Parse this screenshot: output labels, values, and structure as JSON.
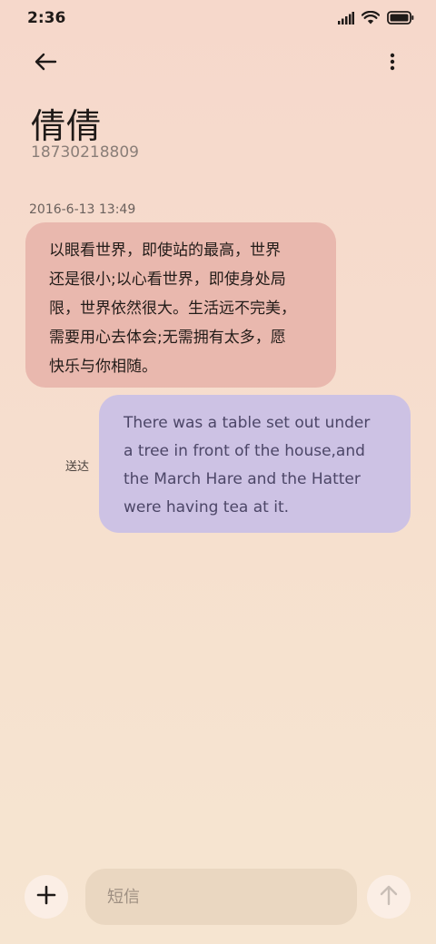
{
  "status_bar": {
    "time": "2:36",
    "icons": [
      "signal-icon",
      "wifi-icon",
      "battery-icon"
    ]
  },
  "header": {
    "back_icon": "back-arrow-icon",
    "more_icon": "more-vertical-icon",
    "contact_name": "倩倩",
    "contact_number": "18730218809"
  },
  "conversation": {
    "timestamp": "2016-6-13 13:49",
    "messages": [
      {
        "direction": "incoming",
        "lines": [
          "以眼看世界，即使站的最高，世界",
          "还是很小;以心看世界，即使身处局",
          "限，世界依然很大。生活远不完美，",
          "需要用心去体会;无需拥有太多，愿",
          "快乐与你相随。"
        ]
      },
      {
        "direction": "outgoing",
        "status": "送达",
        "lines": [
          "There was a table set out under",
          "a tree in front of the house,and",
          "the March Hare and the Hatter",
          "were having tea at it."
        ]
      }
    ]
  },
  "compose": {
    "add_icon": "plus-icon",
    "placeholder": "短信",
    "value": "",
    "send_icon": "send-arrow-icon"
  },
  "colors": {
    "incoming_bubble": "#e9b8ae",
    "outgoing_bubble": "#cdc2e4",
    "outgoing_text": "#4c4667",
    "compose_field": "#ead7c1"
  }
}
